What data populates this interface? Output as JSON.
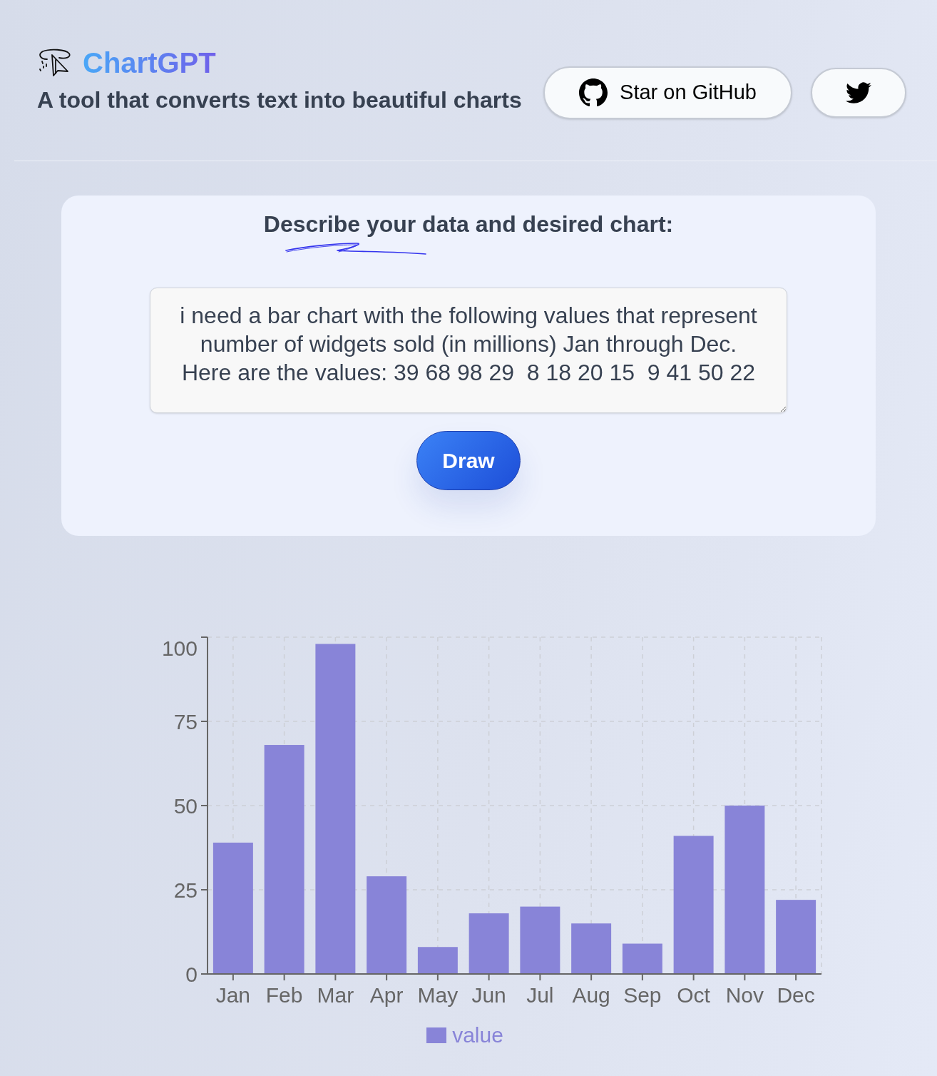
{
  "header": {
    "title": "ChartGPT",
    "subtitle": "A tool that converts text into beautiful charts",
    "buttons": [
      {
        "kind": "github",
        "label": "Star on GitHub"
      },
      {
        "kind": "twitter"
      }
    ]
  },
  "form": {
    "heading": "Describe your data and desired chart:",
    "prompt": {
      "value": "i need a bar chart with the following values that represent number of widgets sold (in millions) Jan through Dec. Here are the values: 39 68 98 29  8 18 20 15  9 41 50 22"
    },
    "submit": "Draw"
  },
  "chart": {
    "chart_data": {
      "type": "bar",
      "categories": [
        "Jan",
        "Feb",
        "Mar",
        "Apr",
        "May",
        "Jun",
        "Jul",
        "Aug",
        "Sep",
        "Oct",
        "Nov",
        "Dec"
      ],
      "series": [
        {
          "name": "value",
          "color": "#8884d8",
          "values": [
            39,
            68,
            98,
            29,
            8,
            18,
            20,
            15,
            9,
            41,
            50,
            22
          ]
        }
      ],
      "ylim": [
        0,
        100
      ],
      "yticks": [
        0,
        25,
        50,
        75,
        100
      ],
      "grid": true
    }
  }
}
